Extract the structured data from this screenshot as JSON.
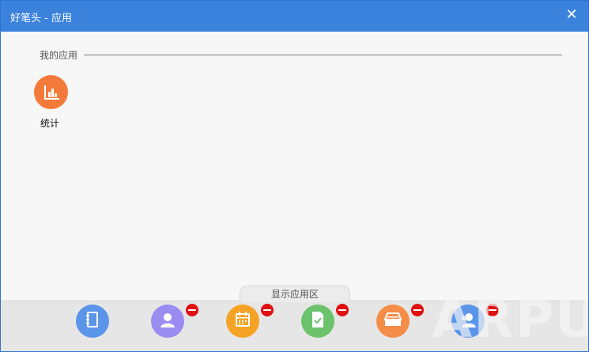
{
  "window": {
    "title": "好笔头 - 应用",
    "close_glyph": "✕"
  },
  "my_apps": {
    "section_label": "我的应用",
    "apps": [
      {
        "label": "统计",
        "icon": "bar-chart-icon",
        "color": "#f47a3b"
      }
    ]
  },
  "tray": {
    "tab_label": "显示应用区",
    "apps": [
      {
        "icon": "notebook-icon",
        "color": "#5b95ea",
        "removable": false
      },
      {
        "icon": "user-icon",
        "color": "#9a8cf0",
        "removable": true
      },
      {
        "icon": "calendar-icon",
        "color": "#f5a324",
        "removable": true
      },
      {
        "icon": "document-check-icon",
        "color": "#6cc36c",
        "removable": true
      },
      {
        "icon": "inbox-tray-icon",
        "color": "#f58c47",
        "removable": true
      },
      {
        "icon": "contacts-icon",
        "color": "#5b95ea",
        "removable": true
      }
    ]
  },
  "watermark": "ARPUN"
}
